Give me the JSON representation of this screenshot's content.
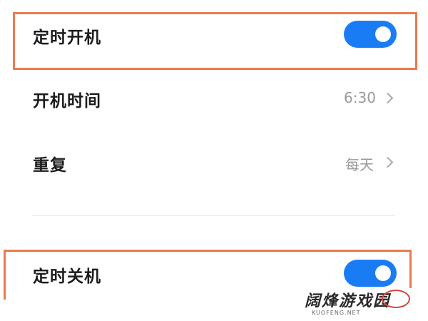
{
  "colors": {
    "toggle_on": "#1a7cf5",
    "highlight": "#e87a4e"
  },
  "scheduled_power_on": {
    "label": "定时开机",
    "enabled": true
  },
  "power_on_time": {
    "label": "开机时间",
    "value": "6:30",
    "icon": "chevron-right-icon"
  },
  "repeat": {
    "label": "重复",
    "value": "每天",
    "icon": "chevron-right-icon"
  },
  "scheduled_power_off": {
    "label": "定时关机",
    "enabled": true
  },
  "watermark": {
    "title": "阔烽游戏园",
    "subtitle": "KUOFENG.NET"
  }
}
